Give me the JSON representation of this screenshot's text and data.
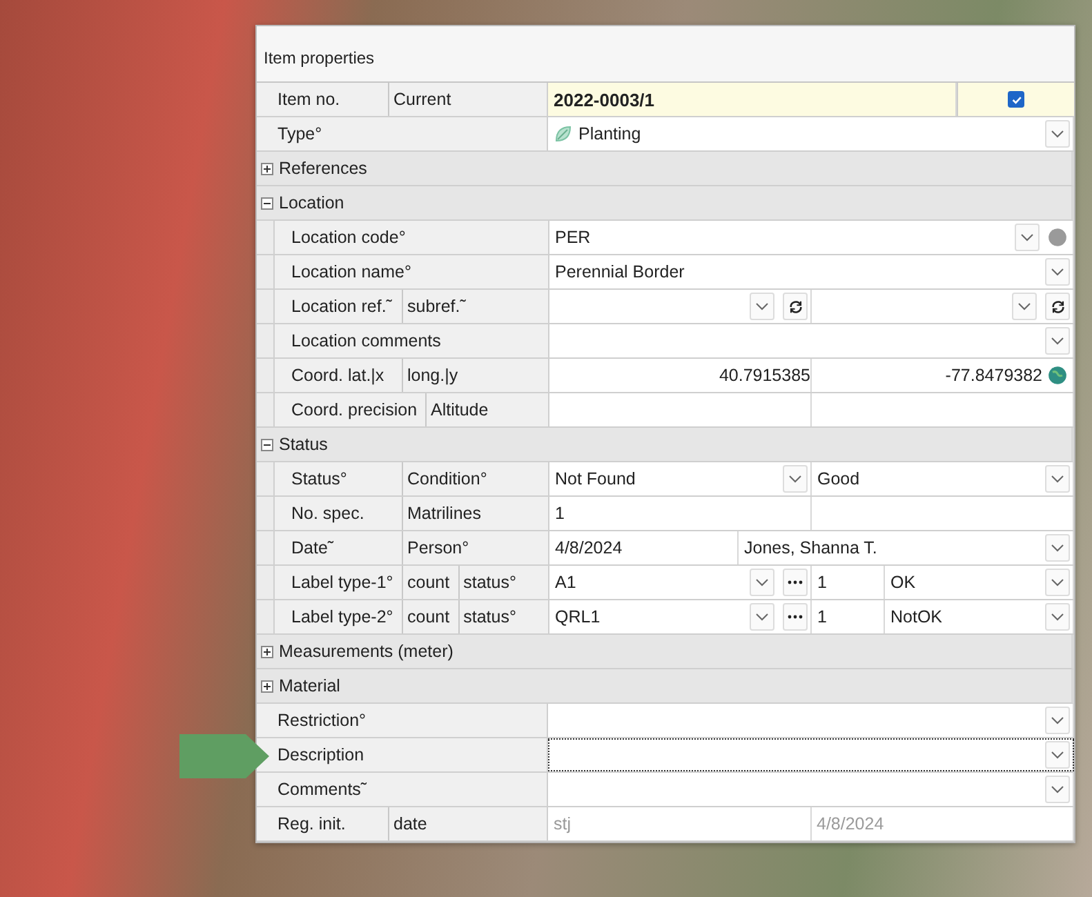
{
  "panel": {
    "title": "Item properties"
  },
  "rows": [
    {
      "kind": "field",
      "labels": [
        "Item no.",
        "Current"
      ],
      "cells": [
        {
          "kind": "id",
          "text": "2022-0003/1",
          "dropdown": false
        },
        {
          "kind": "checkbox",
          "checked": true
        }
      ]
    },
    {
      "kind": "field",
      "labels": [
        "Type°"
      ],
      "cells": [
        {
          "kind": "type",
          "text": "Planting",
          "dropdown": true
        }
      ]
    },
    {
      "kind": "group",
      "label": "References",
      "expanded": false
    },
    {
      "kind": "group",
      "label": "Location",
      "expanded": true,
      "children": [
        {
          "kind": "field",
          "labels": [
            "Location code°"
          ],
          "cells": [
            {
              "kind": "code",
              "text": "PER",
              "dropdown": true
            }
          ]
        },
        {
          "kind": "field",
          "labels": [
            "Location name°"
          ],
          "cells": [
            {
              "kind": "text",
              "text": "Perennial Border",
              "dropdown": true
            }
          ]
        },
        {
          "kind": "field",
          "labels": [
            "Location ref.˜",
            "subref.˜"
          ],
          "cells": [
            {
              "kind": "reference",
              "dropdown": true
            },
            {
              "kind": "reference",
              "dropdown": true
            }
          ]
        },
        {
          "kind": "field",
          "labels": [
            "Location comments"
          ],
          "cells": [
            {
              "kind": "text",
              "dropdown": true
            }
          ]
        },
        {
          "kind": "field",
          "labels": [
            "Coord. lat.|x",
            "long.|y"
          ],
          "cells": [
            {
              "kind": "number",
              "text": "40.7915385",
              "dropdown": false
            },
            {
              "kind": "coordinate",
              "text": "-77.8479382",
              "dropdown": false
            }
          ]
        },
        {
          "kind": "field",
          "labels": [
            "Coord. precision",
            "Altitude"
          ],
          "cells": [
            {
              "kind": "text",
              "dropdown": false
            },
            {
              "kind": "text",
              "dropdown": false
            }
          ]
        }
      ]
    },
    {
      "kind": "group",
      "label": "Status",
      "expanded": true,
      "children": [
        {
          "kind": "field",
          "labels": [
            "Status°",
            "Condition°"
          ],
          "cells": [
            {
              "kind": "text",
              "text": "Not Found",
              "dropdown": true
            },
            {
              "kind": "text",
              "text": "Good",
              "dropdown": true
            }
          ]
        },
        {
          "kind": "field",
          "labels": [
            "No. spec.",
            "Matrilines"
          ],
          "cells": [
            {
              "kind": "text",
              "text": "1",
              "dropdown": false
            },
            {
              "kind": "text",
              "dropdown": false
            }
          ]
        },
        {
          "kind": "field",
          "labels": [
            "Date˜",
            "Person°"
          ],
          "cells": [
            {
              "kind": "narrow",
              "text": "4/8/2024",
              "dropdown": false
            },
            {
              "kind": "text",
              "text": "Jones, Shanna T.",
              "dropdown": true
            }
          ]
        },
        {
          "kind": "field",
          "labels": [
            "Label type-1°",
            "count",
            "status°"
          ],
          "cells": [
            {
              "kind": "label",
              "text": "A1",
              "dropdown": true
            },
            {
              "kind": "count",
              "text": "1",
              "dropdown": false
            },
            {
              "kind": "narrow",
              "text": "OK",
              "dropdown": true
            }
          ]
        },
        {
          "kind": "field",
          "labels": [
            "Label type-2°",
            "count",
            "status°"
          ],
          "cells": [
            {
              "kind": "label",
              "text": "QRL1",
              "dropdown": true
            },
            {
              "kind": "count",
              "text": "1",
              "dropdown": false
            },
            {
              "kind": "narrow",
              "text": "NotOK",
              "dropdown": true
            }
          ]
        }
      ]
    },
    {
      "kind": "group",
      "label": "Measurements (meter)",
      "expanded": false
    },
    {
      "kind": "group",
      "label": "Material",
      "expanded": false
    },
    {
      "kind": "field",
      "labels": [
        "Restriction°"
      ],
      "cells": [
        {
          "kind": "text",
          "dropdown": true
        }
      ]
    },
    {
      "kind": "field",
      "labels": [
        "Description"
      ],
      "pointer": true,
      "cells": [
        {
          "kind": "text",
          "dropdown": true,
          "focused": true
        }
      ]
    },
    {
      "kind": "field",
      "labels": [
        "Comments˜"
      ],
      "cells": [
        {
          "kind": "text",
          "dropdown": true
        }
      ]
    },
    {
      "kind": "field",
      "labels": [
        "Reg. init.",
        "date"
      ],
      "cells": [
        {
          "kind": "text",
          "text": "stj",
          "dropdown": false,
          "disabled": true
        },
        {
          "kind": "text",
          "text": "4/8/2024",
          "dropdown": false,
          "disabled": true
        }
      ]
    }
  ]
}
